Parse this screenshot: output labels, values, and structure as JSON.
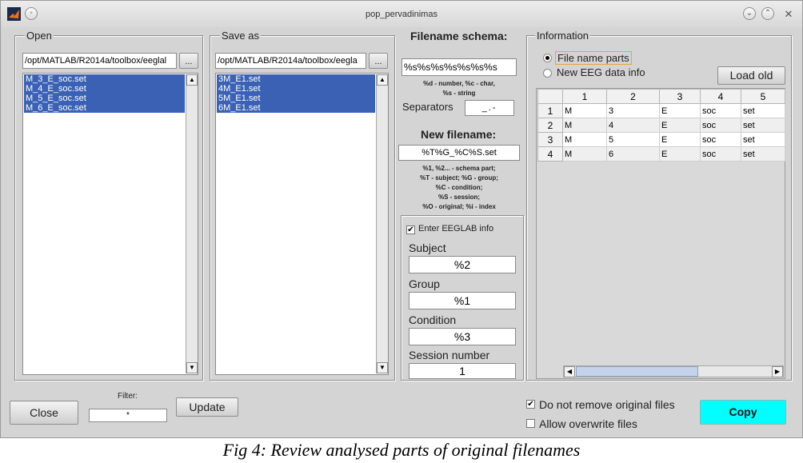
{
  "window": {
    "title": "pop_pervadinimas"
  },
  "open_panel": {
    "legend": "Open",
    "path": "/opt/MATLAB/R2014a/toolbox/eeglal",
    "browse_label": "...",
    "files": [
      "M_3_E_soc.set",
      "M_4_E_soc.set",
      "M_5_E_soc.set",
      "M_6_E_soc.set"
    ]
  },
  "save_panel": {
    "legend": "Save as",
    "path": "/opt/MATLAB/R2014a/toolbox/eegla",
    "browse_label": "...",
    "files": [
      "3M_E1.set",
      "4M_E1.set",
      "5M_E1.set",
      "6M_E1.set"
    ]
  },
  "schema": {
    "heading": "Filename schema:",
    "value": "%s%s%s%s%s%s%s",
    "hint_line1": "%d - number, %c - char,",
    "hint_line2": "%s - string",
    "separators_label": "Separators",
    "separators_value": "_.-",
    "new_filename_heading": "New filename:",
    "new_filename_value": "%T%G_%C%S.set",
    "help_lines": [
      "%1, %2... - schema part;",
      "%T - subject; %G - group;",
      "%C - condition;",
      "%S - session;",
      "%O - original; %i - index"
    ]
  },
  "eeglab": {
    "enter_label": "Enter EEGLAB info",
    "enter_checked": true,
    "subject_label": "Subject",
    "subject_value": "%2",
    "group_label": "Group",
    "group_value": "%1",
    "condition_label": "Condition",
    "condition_value": "%3",
    "session_label": "Session number",
    "session_value": "1"
  },
  "information": {
    "legend": "Information",
    "radio_parts": "File name parts",
    "radio_eeg": "New EEG data info",
    "load_old_label": "Load old",
    "columns": [
      "1",
      "2",
      "3",
      "4",
      "5"
    ],
    "rows": [
      {
        "index": "1",
        "cells": [
          "M",
          "3",
          "E",
          "soc",
          "set"
        ]
      },
      {
        "index": "2",
        "cells": [
          "M",
          "4",
          "E",
          "soc",
          "set"
        ]
      },
      {
        "index": "3",
        "cells": [
          "M",
          "5",
          "E",
          "soc",
          "set"
        ]
      },
      {
        "index": "4",
        "cells": [
          "M",
          "6",
          "E",
          "soc",
          "set"
        ]
      }
    ]
  },
  "bottom": {
    "close_label": "Close",
    "filter_label": "Filter:",
    "filter_value": "*",
    "update_label": "Update",
    "keep_originals_label": "Do not remove original files",
    "keep_originals_checked": true,
    "overwrite_label": "Allow overwrite files",
    "overwrite_checked": false,
    "copy_label": "Copy"
  },
  "colors": {
    "selection": "#3a61b4",
    "copy_button": "#00ffff",
    "window_bg": "#d4d4d4"
  },
  "caption": "Fig 4: Review analysed parts of original filenames"
}
